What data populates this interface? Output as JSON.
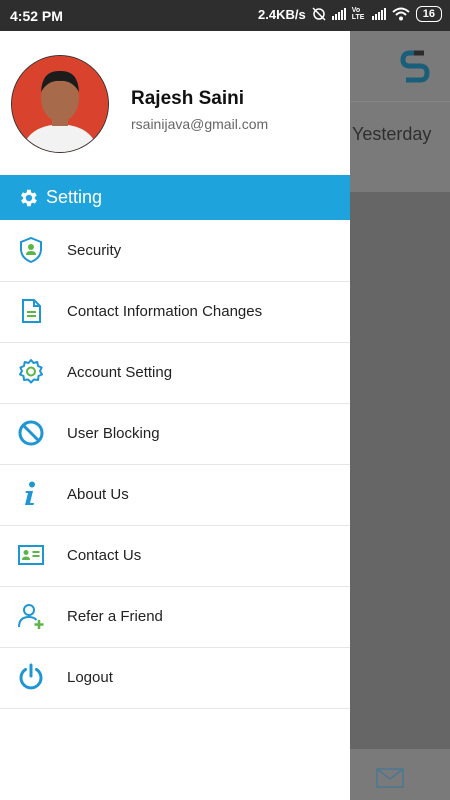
{
  "status_bar": {
    "time": "4:52 PM",
    "network_speed": "2.4KB/s",
    "carrier": "Vo LTE",
    "battery": "16"
  },
  "background": {
    "list_item_time": "Yesterday"
  },
  "drawer": {
    "user": {
      "name": "Rajesh Saini",
      "email": "rsainijava@gmail.com"
    },
    "section_title": "Setting",
    "menu_items": [
      {
        "label": "Security",
        "icon": "shield-user-icon"
      },
      {
        "label": "Contact Information Changes",
        "icon": "document-icon"
      },
      {
        "label": "Account Setting",
        "icon": "gear-icon"
      },
      {
        "label": "User Blocking",
        "icon": "block-icon"
      },
      {
        "label": "About Us",
        "icon": "info-icon"
      },
      {
        "label": "Contact Us",
        "icon": "contact-card-icon"
      },
      {
        "label": "Refer a Friend",
        "icon": "add-user-icon"
      },
      {
        "label": "Logout",
        "icon": "power-icon"
      }
    ]
  },
  "colors": {
    "accent": "#1ea3dc",
    "icon_green": "#5bb548"
  }
}
